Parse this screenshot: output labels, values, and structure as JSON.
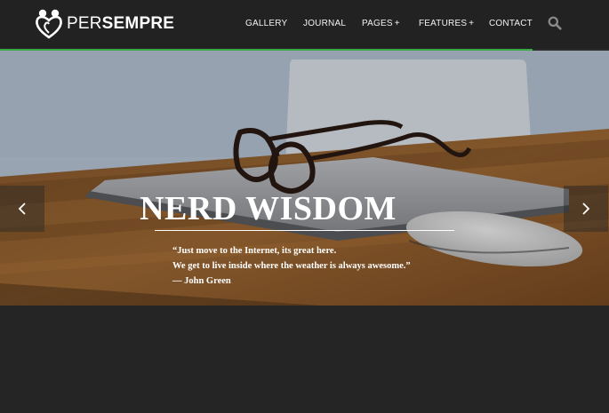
{
  "brand": {
    "name_light": "PER",
    "name_bold": "SEMPRE"
  },
  "nav": {
    "items": [
      {
        "label": "GALLERY",
        "plus": ""
      },
      {
        "label": "JOURNAL",
        "plus": ""
      },
      {
        "label": "PAGES",
        "plus": "+"
      },
      {
        "label": "FEATURES",
        "plus": "+"
      },
      {
        "label": "CONTACT",
        "plus": ""
      }
    ],
    "search_icon": "search-icon"
  },
  "slider": {
    "progress": 0.875,
    "title": "NERD WISDOM",
    "quote_line_1": "“Just move to the Internet, its great here.",
    "quote_line_2": "We get to live inside where the weather is always awesome.”",
    "quote_author": "— John Green",
    "prev_icon": "chevron-left-icon",
    "next_icon": "chevron-right-icon"
  },
  "colors": {
    "accent": "#3aa845",
    "header_bg": "#222222",
    "page_bg": "#252525"
  }
}
